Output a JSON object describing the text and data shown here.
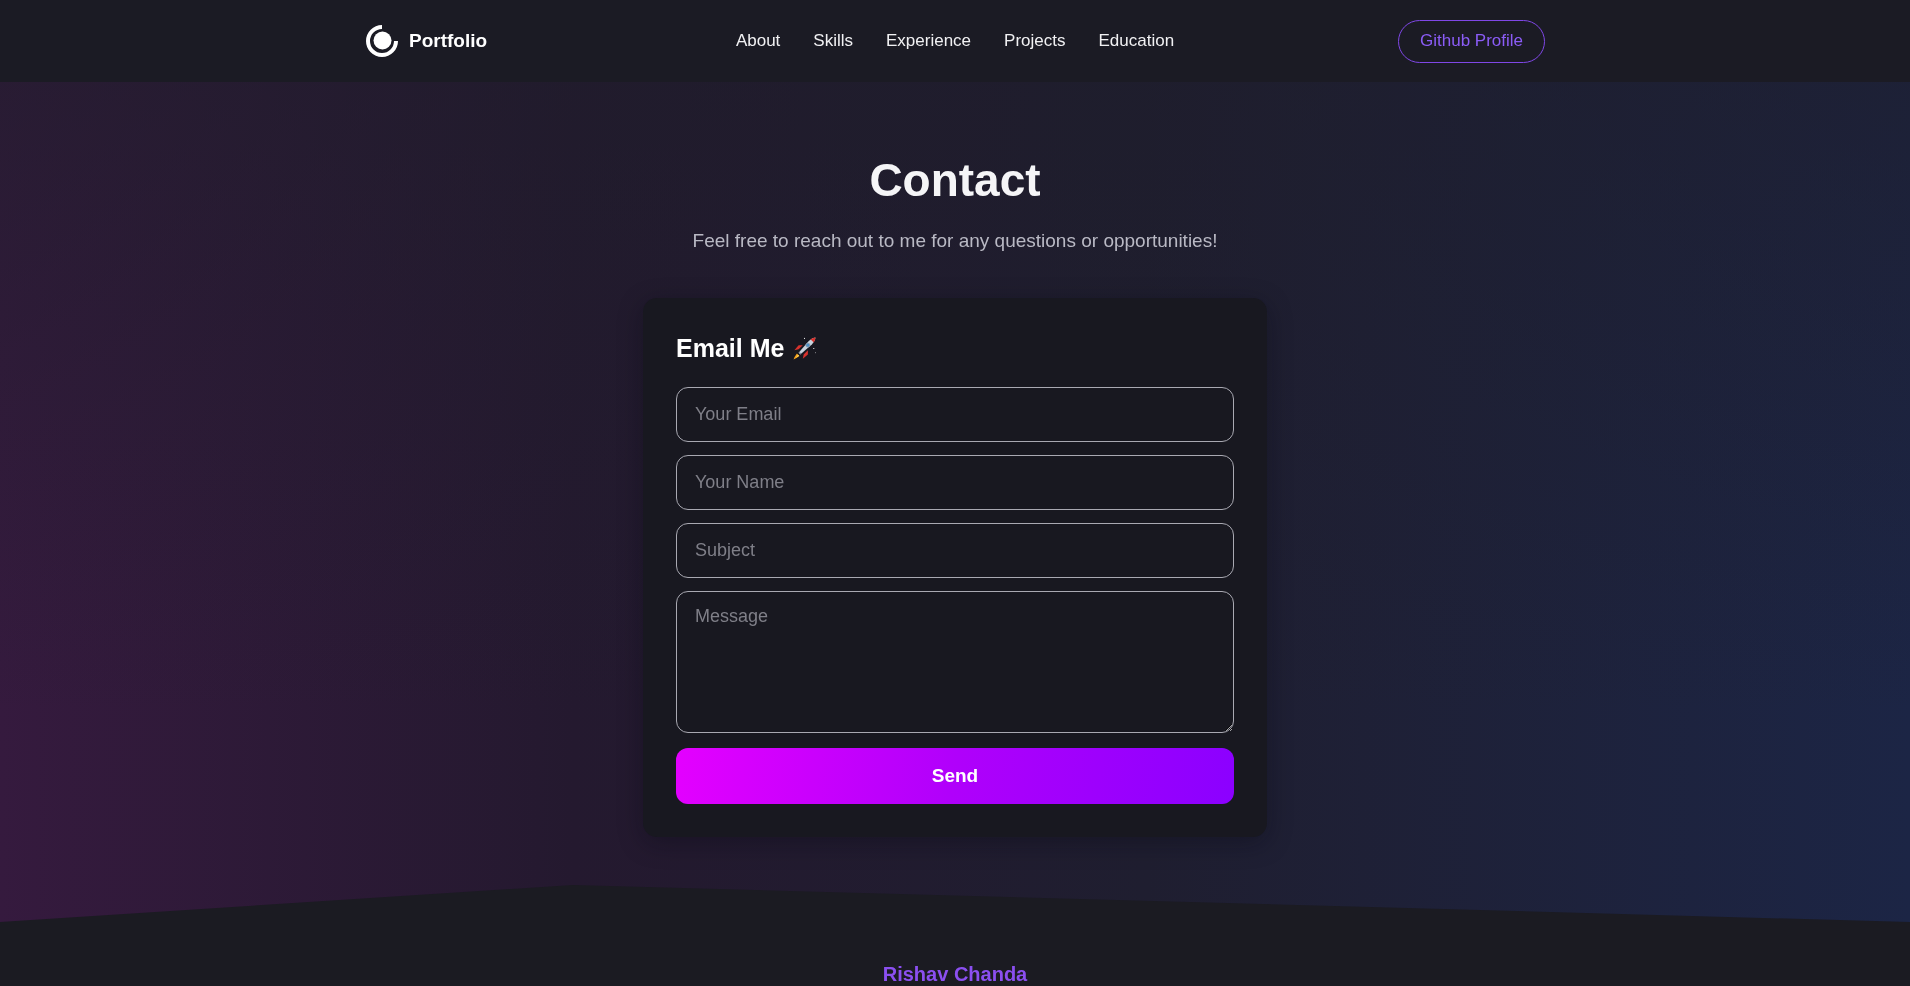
{
  "header": {
    "logo": {
      "text": "Portfolio"
    },
    "nav": [
      "About",
      "Skills",
      "Experience",
      "Projects",
      "Education"
    ],
    "button": "Github Profile"
  },
  "contact": {
    "title": "Contact",
    "subtitle": "Feel free to reach out to me for any questions or opportunities!",
    "form": {
      "title": "Email Me",
      "fields": [
        {
          "kind": "input",
          "placeholder": "Your Email"
        },
        {
          "kind": "input",
          "placeholder": "Your Name"
        },
        {
          "kind": "input",
          "placeholder": "Subject"
        },
        {
          "kind": "textarea",
          "placeholder": "Message"
        }
      ],
      "submit": "Send"
    }
  },
  "footer": {
    "name": "Rishav Chanda"
  }
}
